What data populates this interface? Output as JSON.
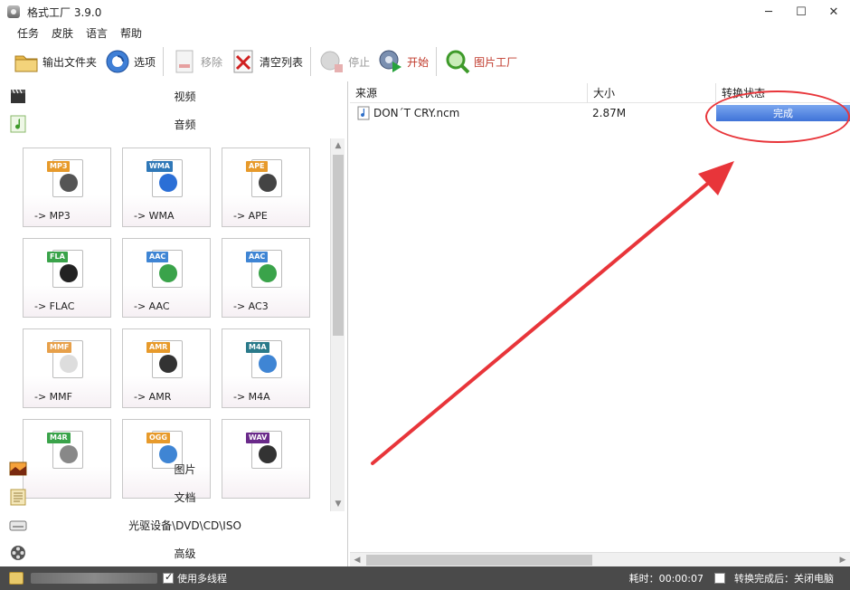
{
  "window": {
    "title": "格式工厂 3.9.0",
    "controls": [
      "─",
      "☐",
      "✕"
    ]
  },
  "menu": [
    "任务",
    "皮肤",
    "语言",
    "帮助"
  ],
  "toolbar": {
    "output_folder": "输出文件夹",
    "options": "选项",
    "remove": "移除",
    "clear_list": "清空列表",
    "stop": "停止",
    "start": "开始",
    "picture_factory": "图片工厂"
  },
  "categories": {
    "video": "视频",
    "audio": "音频",
    "picture": "图片",
    "document": "文档",
    "optical": "光驱设备\\DVD\\CD\\ISO",
    "advanced": "高级"
  },
  "audio_formats": [
    {
      "badge": "MP3",
      "label": "-> MP3",
      "badge_color": "#e79a2b",
      "glyph_color": "#555555"
    },
    {
      "badge": "WMA",
      "label": "-> WMA",
      "badge_color": "#2f78b8",
      "glyph_color": "#2b6fd6"
    },
    {
      "badge": "APE",
      "label": "-> APE",
      "badge_color": "#e79a2b",
      "glyph_color": "#444444"
    },
    {
      "badge": "FLA",
      "label": "-> FLAC",
      "badge_color": "#3aa34a",
      "glyph_color": "#222222"
    },
    {
      "badge": "AAC",
      "label": "-> AAC",
      "badge_color": "#3f85d4",
      "glyph_color": "#3aa34a"
    },
    {
      "badge": "AAC",
      "label": "-> AC3",
      "badge_color": "#3f85d4",
      "glyph_color": "#3aa34a"
    },
    {
      "badge": "MMF",
      "label": "-> MMF",
      "badge_color": "#e7a04a",
      "glyph_color": "#dddddd"
    },
    {
      "badge": "AMR",
      "label": "-> AMR",
      "badge_color": "#e79a2b",
      "glyph_color": "#333333"
    },
    {
      "badge": "M4A",
      "label": "-> M4A",
      "badge_color": "#2a7a8a",
      "glyph_color": "#3f85d4"
    },
    {
      "badge": "M4R",
      "label": "",
      "badge_color": "#3aa34a",
      "glyph_color": "#888888"
    },
    {
      "badge": "OGG",
      "label": "",
      "badge_color": "#e79a2b",
      "glyph_color": "#3f85d4"
    },
    {
      "badge": "WAV",
      "label": "",
      "badge_color": "#6a2a8a",
      "glyph_color": "#333333"
    }
  ],
  "task_list": {
    "headers": {
      "source": "来源",
      "size": "大小",
      "status": "转换状态"
    },
    "rows": [
      {
        "source": "DON´T CRY.ncm",
        "size": "2.87M",
        "status": "完成"
      }
    ]
  },
  "statusbar": {
    "multithread_label": "使用多线程",
    "elapsed": "耗时：00:00:07",
    "after_convert_label": "转换完成后：关闭电脑"
  },
  "colors": {
    "annotation": "#e8353a",
    "progress": "#4a7fe0",
    "statusbar_bg": "#4a4a4a"
  }
}
